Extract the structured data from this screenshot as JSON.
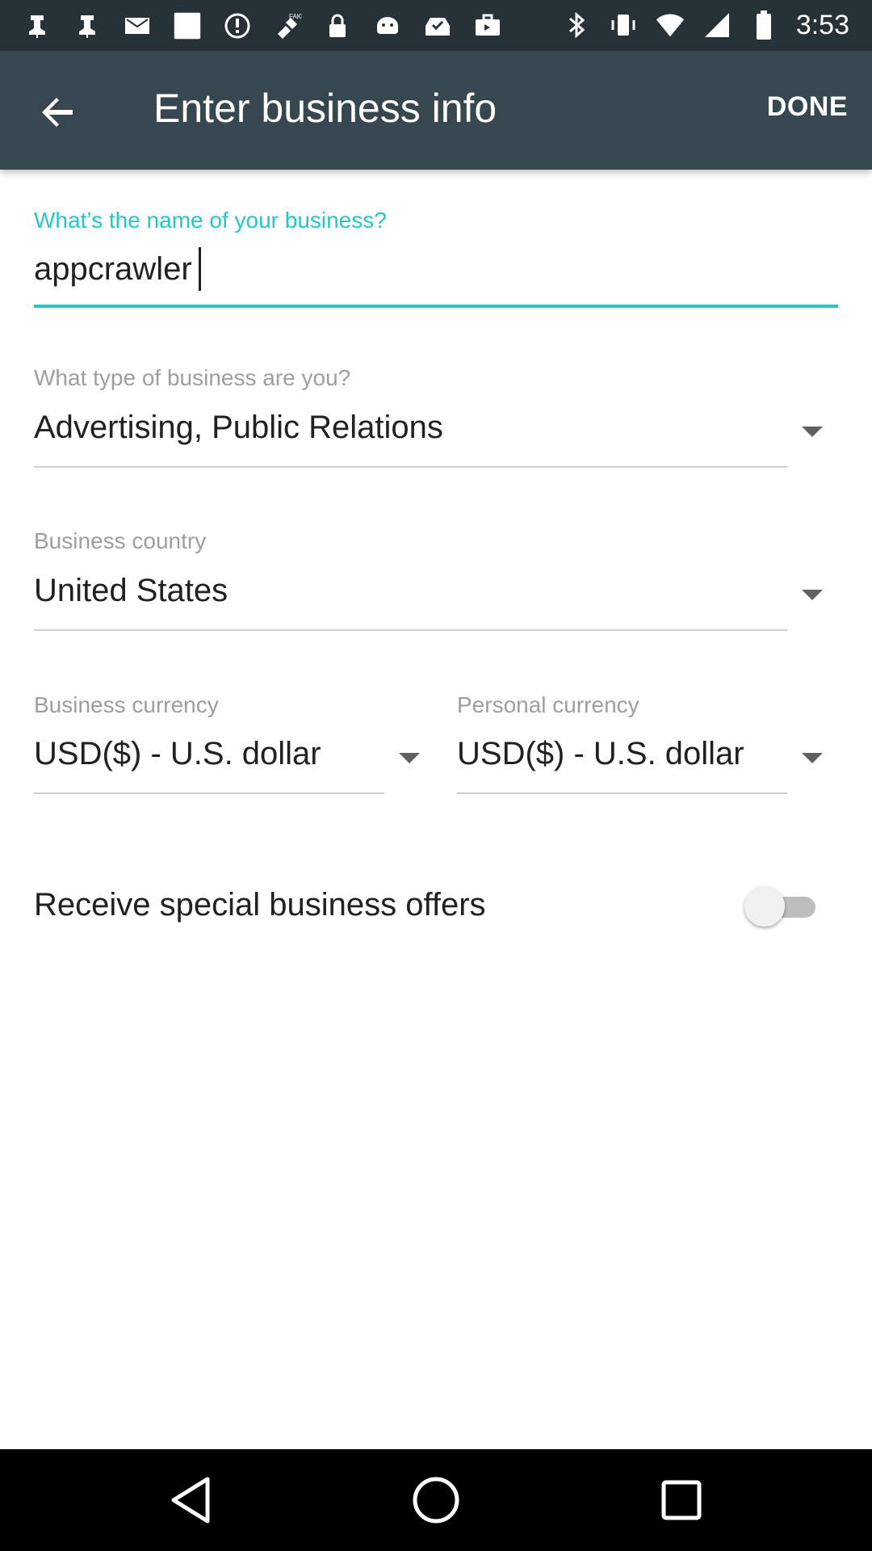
{
  "status_bar": {
    "time": "3:53",
    "left_icons": [
      "notification-icon",
      "notification-icon",
      "mail-icon",
      "square-icon",
      "info-icon",
      "fake-gps-icon",
      "lock-icon",
      "android-icon",
      "inbox-icon",
      "briefcase-icon"
    ],
    "right_icons": [
      "bluetooth-icon",
      "vibrate-icon",
      "wifi-icon",
      "signal-icon",
      "battery-icon"
    ]
  },
  "app_bar": {
    "title": "Enter business info",
    "back_icon": "arrow-back-icon",
    "done_label": "DONE"
  },
  "form": {
    "business_name": {
      "label": "What’s the name of your business?",
      "value": "appcrawler"
    },
    "business_type": {
      "label": "What type of business are you?",
      "value": "Advertising, Public Relations"
    },
    "business_country": {
      "label": "Business country",
      "value": "United States"
    },
    "business_currency": {
      "label": "Business currency",
      "value": "USD($) - U.S. dollar"
    },
    "personal_currency": {
      "label": "Personal currency",
      "value": "USD($) - U.S. dollar"
    },
    "offers": {
      "label": "Receive special business offers",
      "enabled": false
    }
  },
  "colors": {
    "status_bar": "#263238",
    "app_bar": "#37474f",
    "accent": "#26c6c6"
  }
}
